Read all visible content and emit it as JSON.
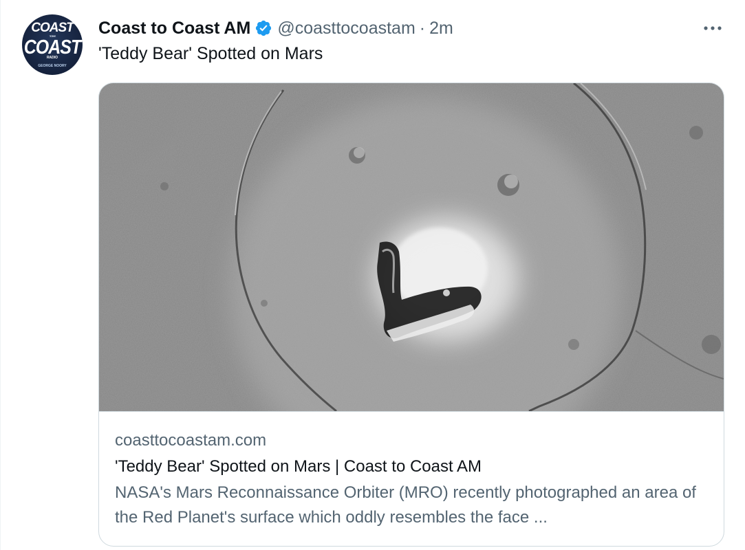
{
  "tweet": {
    "author": {
      "display_name": "Coast to Coast AM",
      "handle": "@coasttocoastam",
      "verified_icon": "verified-badge-icon",
      "avatar_logo": {
        "line1": "COAST",
        "line_mid": "TO THE",
        "line2": "COAST",
        "line3": "RADIO",
        "line4": "GEORGE NOORY"
      }
    },
    "separator": "·",
    "time": "2m",
    "more_icon": "more-horizontal-icon",
    "text": "'Teddy Bear' Spotted on Mars",
    "card": {
      "image_icon": "mars-surface-teddy-bear-photo",
      "domain": "coasttocoastam.com",
      "title": "'Teddy Bear' Spotted on Mars | Coast to Coast AM",
      "description": "NASA's Mars Reconnaissance Orbiter (MRO) recently photographed an area of the Red Planet's surface which oddly resembles the face ..."
    }
  },
  "colors": {
    "text_primary": "#0f1419",
    "text_secondary": "#536471",
    "verified_blue": "#1d9bf0",
    "border": "#cfd9de"
  }
}
